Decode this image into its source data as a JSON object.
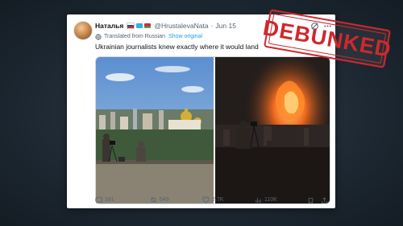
{
  "tweet": {
    "display_name": "Наталья",
    "handle": "@HrustalevaNata",
    "date": "Jun 15",
    "translated_label": "Translated from Russian",
    "show_original_label": "Show original",
    "text": "Ukrainian journalists knew exactly where it would land",
    "icons": {
      "verified_flags": [
        "russia-flag-icon",
        "kazakhstan-flag-icon",
        "belarus-flag-icon"
      ],
      "grok": "grok-icon",
      "more": "more-icon"
    }
  },
  "media": {
    "photos": [
      "journalists-filming-city-skyline-photo",
      "night-explosion-photo"
    ]
  },
  "actions": {
    "replies": "161",
    "reposts": "549",
    "likes": "2.7K",
    "views": "110K"
  },
  "stamp": {
    "label": "DEBUNKED",
    "color": "#d0282c"
  }
}
